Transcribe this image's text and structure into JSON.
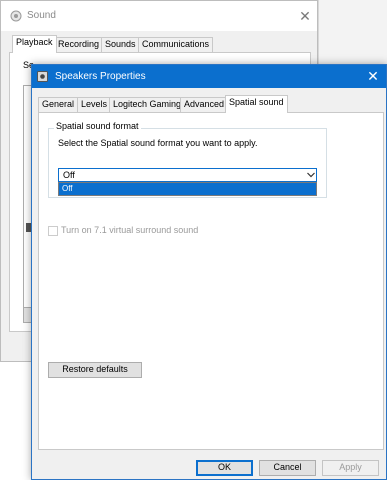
{
  "sound_window": {
    "title": "Sound",
    "icon": "speaker-icon",
    "close_glyph": "✕",
    "tabs": [
      {
        "label": "Playback",
        "active": true
      },
      {
        "label": "Recording",
        "active": false
      },
      {
        "label": "Sounds",
        "active": false
      },
      {
        "label": "Communications",
        "active": false
      }
    ],
    "instruction_partial": "Se"
  },
  "dialog": {
    "title": "Speakers Properties",
    "icon": "speaker-icon",
    "close_glyph": "✕",
    "accent": "#0b6fce",
    "tabs": [
      {
        "label": "General",
        "active": false
      },
      {
        "label": "Levels",
        "active": false
      },
      {
        "label": "Logitech Gaming",
        "active": false
      },
      {
        "label": "Advanced",
        "active": false
      },
      {
        "label": "Spatial sound",
        "active": true
      }
    ],
    "group_label": "Spatial sound format",
    "instruction": "Select the Spatial sound format you want to apply.",
    "format_select": {
      "selected": "Off",
      "options": [
        "Off"
      ],
      "expanded": true,
      "arrow_icon": "chevron-down-icon",
      "arrow_glyph": "⌄"
    },
    "surround_checkbox": {
      "label": "Turn on 7.1 virtual surround sound",
      "checked": false,
      "enabled": false
    },
    "buttons": {
      "restore": "Restore defaults",
      "ok": "OK",
      "cancel": "Cancel",
      "apply": "Apply"
    }
  }
}
